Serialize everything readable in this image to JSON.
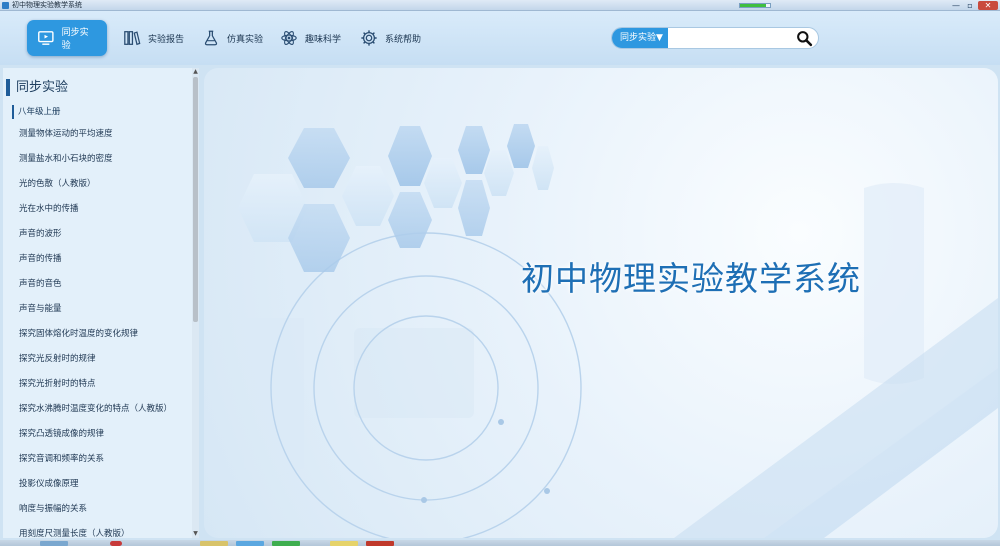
{
  "window": {
    "title": "初中物理实验教学系统",
    "min_glyph": "—",
    "max_glyph": "▫",
    "close_glyph": "✕",
    "progress": 0.85
  },
  "toolbar": {
    "nav": [
      {
        "label": "同步实验",
        "icon": "monitor-play-icon",
        "active": true
      },
      {
        "label": "实验报告",
        "icon": "books-icon",
        "active": false
      },
      {
        "label": "仿真实验",
        "icon": "flask-icon",
        "active": false
      },
      {
        "label": "趣味科学",
        "icon": "atom-icon",
        "active": false
      },
      {
        "label": "系统帮助",
        "icon": "gear-icon",
        "active": false
      }
    ],
    "search": {
      "scope_label": "同步实验▼",
      "value": "",
      "placeholder": ""
    }
  },
  "sidebar": {
    "heading": "同步实验",
    "grade": "八年级上册",
    "items": [
      "测量物体运动的平均速度",
      "测量盐水和小石块的密度",
      "光的色散（人教版）",
      "光在水中的传播",
      "声音的波形",
      "声音的传播",
      "声音的音色",
      "声音与能量",
      "探究固体熔化时温度的变化规律",
      "探究光反射时的规律",
      "探究光折射时的特点",
      "探究水沸腾时温度变化的特点（人教版）",
      "探究凸透镜成像的规律",
      "探究音调和频率的关系",
      "投影仪成像原理",
      "响度与振幅的关系",
      "用刻度尺测量长度（人教版）"
    ]
  },
  "main": {
    "title": "初中物理实验教学系统"
  },
  "colors": {
    "accent": "#2e98e0",
    "title_blue": "#1e6fb5",
    "sidebar_bg": "#e3f0fa"
  }
}
